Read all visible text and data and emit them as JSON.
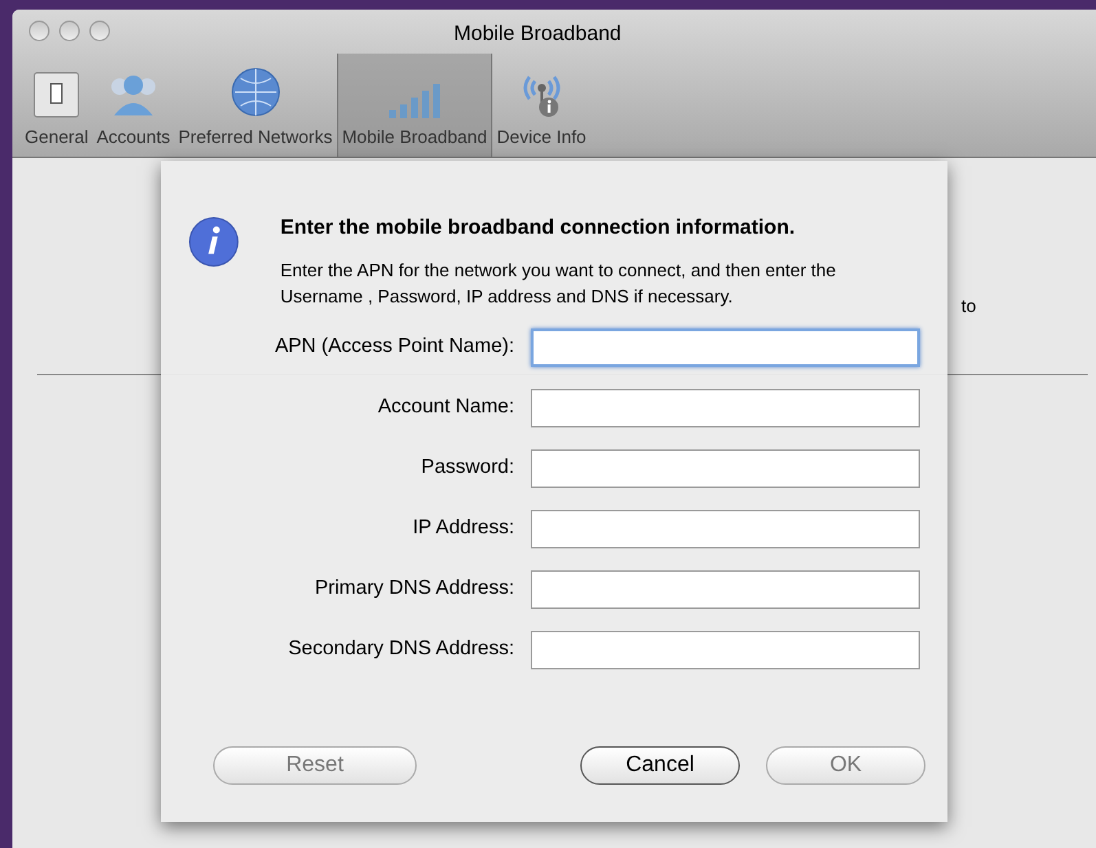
{
  "window": {
    "title": "Mobile Broadband"
  },
  "toolbar": [
    {
      "label": "General",
      "kind": "switch",
      "selected": false
    },
    {
      "label": "Accounts",
      "kind": "people",
      "selected": false
    },
    {
      "label": "Preferred Networks",
      "kind": "globe",
      "selected": false
    },
    {
      "label": "Mobile Broadband",
      "kind": "signal",
      "selected": true
    },
    {
      "label": "Device Info",
      "kind": "antenna",
      "selected": false
    }
  ],
  "background_text": "to",
  "dialog": {
    "heading": "Enter the mobile broadband connection information.",
    "message": "Enter the APN for the network you want to connect, and then enter the Username , Password, IP address and DNS if necessary.",
    "fields": [
      {
        "label": "APN (Access Point Name):",
        "focused": true
      },
      {
        "label": "Account Name:",
        "focused": false
      },
      {
        "label": "Password:",
        "focused": false
      },
      {
        "label": "IP Address:",
        "focused": false
      },
      {
        "label": "Primary DNS Address:",
        "focused": false
      },
      {
        "label": "Secondary DNS Address:",
        "focused": false
      }
    ],
    "buttons": [
      {
        "label": "Reset",
        "kind": "left",
        "disabled": true
      },
      {
        "label": "Cancel",
        "kind": "right",
        "disabled": false
      },
      {
        "label": "OK",
        "kind": "right",
        "disabled": true
      }
    ]
  }
}
